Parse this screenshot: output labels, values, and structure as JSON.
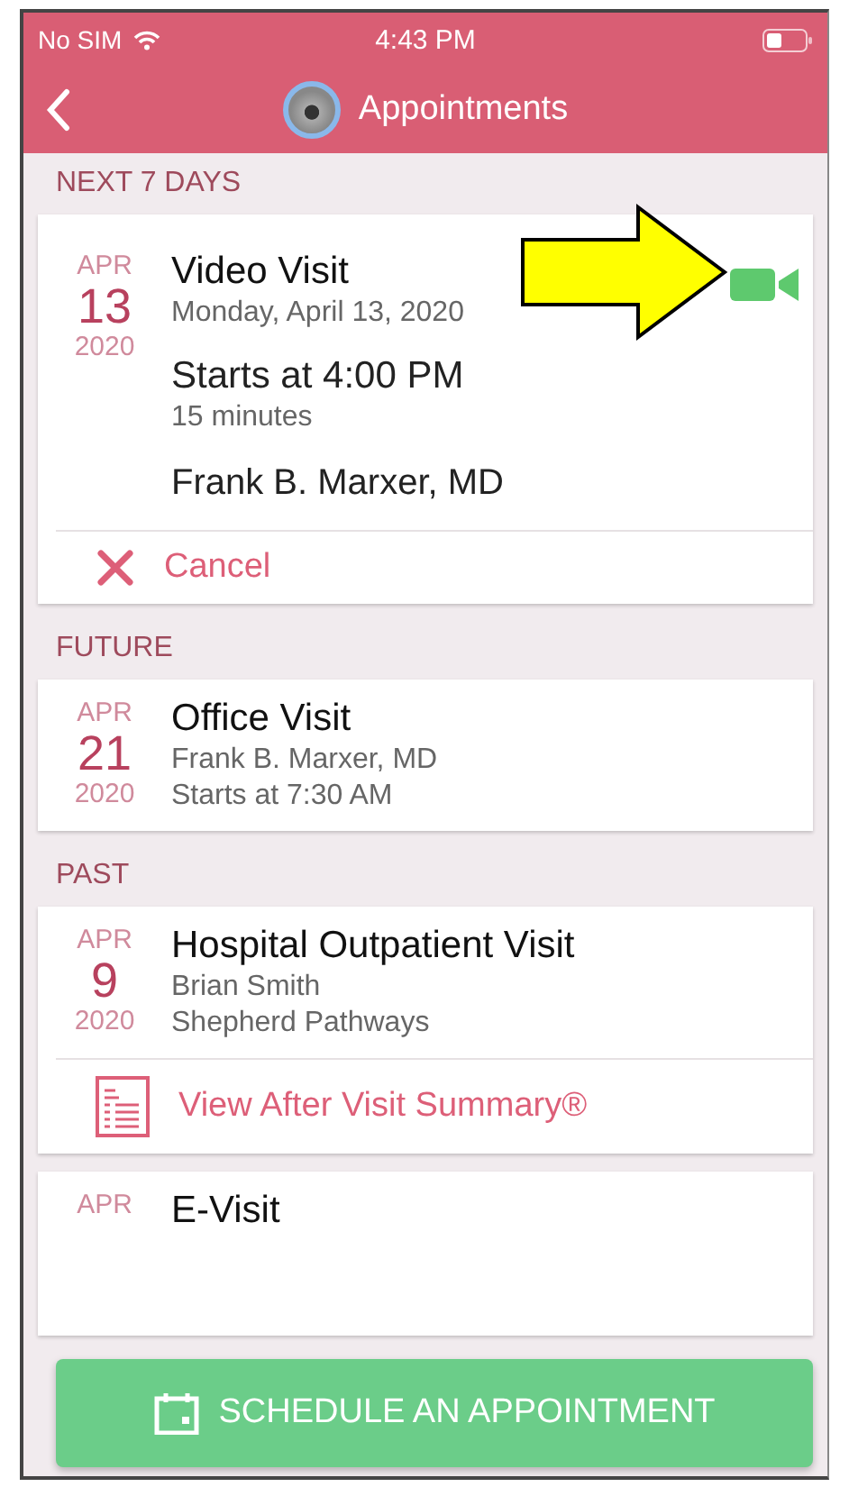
{
  "status_bar": {
    "carrier": "No SIM",
    "time": "4:43 PM"
  },
  "nav": {
    "title": "Appointments"
  },
  "sections": [
    {
      "heading": "NEXT 7 DAYS",
      "cards": [
        {
          "kind": "video",
          "month": "APR",
          "day": "13",
          "year": "2020",
          "title": "Video Visit",
          "lines": [
            "Monday, April 13, 2020"
          ],
          "start": "Starts at 4:00 PM",
          "duration": "15 minutes",
          "provider": "Frank B. Marxer, MD",
          "action": {
            "kind": "cancel",
            "label": "Cancel"
          }
        }
      ]
    },
    {
      "heading": "FUTURE",
      "cards": [
        {
          "kind": "basic",
          "month": "APR",
          "day": "21",
          "year": "2020",
          "title": "Office Visit",
          "lines": [
            "Frank B. Marxer, MD",
            "Starts at 7:30 AM"
          ]
        }
      ]
    },
    {
      "heading": "PAST",
      "cards": [
        {
          "kind": "basic",
          "month": "APR",
          "day": "9",
          "year": "2020",
          "title": "Hospital Outpatient Visit",
          "lines": [
            "Brian Smith",
            "Shepherd Pathways"
          ],
          "action": {
            "kind": "summary",
            "label": "View After Visit Summary®"
          }
        },
        {
          "kind": "basic",
          "month": "APR",
          "title": "E-Visit"
        }
      ]
    }
  ],
  "schedule_button": {
    "label": "SCHEDULE AN APPOINTMENT"
  }
}
